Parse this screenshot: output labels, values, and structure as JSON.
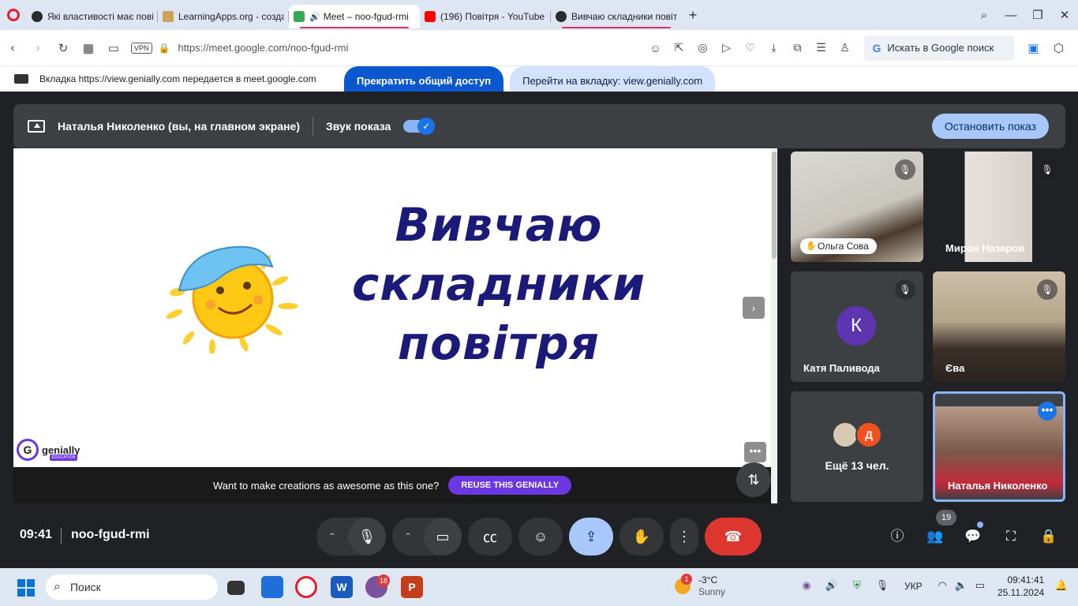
{
  "browser": {
    "tabs": [
      {
        "title": "Які властивості має пові",
        "favicon_color": "#2b2b2b",
        "active": false
      },
      {
        "title": "LearningApps.org - созда",
        "favicon_color": "#c9a45a",
        "active": false
      },
      {
        "title": "Meet – noo-fgud-rmi",
        "favicon_color": "#34a853",
        "active": true
      },
      {
        "title": "(196) Повітря - YouTube",
        "favicon_color": "#ff0000",
        "active": false
      },
      {
        "title": "Вивчаю складники повітр",
        "favicon_color": "#2b2b2b",
        "active": false
      }
    ],
    "url": "https://meet.google.com/noo-fgud-rmi",
    "vpn_label": "VPN",
    "search_placeholder": "Искать в Google поиск"
  },
  "sharing_bar": {
    "text": "Вкладка https://view.genially.com передается в meet.google.com",
    "stop_sharing": "Прекратить общий доступ",
    "go_to_tab": "Перейти на вкладку: view.genially.com"
  },
  "presentation": {
    "presenter": "Наталья Николенко (вы, на главном экране)",
    "sound_label": "Звук показа",
    "sound_on": true,
    "stop_button": "Остановить показ"
  },
  "slide": {
    "title_lines": [
      "Вивчаю",
      "складники",
      "повітря"
    ],
    "logo_text": "genially",
    "logo_badge": "EDUCATION",
    "reuse_text": "Want to make creations as awesome as this one?",
    "reuse_button": "REUSE THIS GENIALLY"
  },
  "participants": [
    {
      "name": "Ольга Сова",
      "muted": true,
      "hand_raised": true
    },
    {
      "name": "Мирон Назаров",
      "muted": true
    },
    {
      "name": "Катя Паливода",
      "muted": true,
      "initial": "К",
      "avatar_color": "#5e35b1"
    },
    {
      "name": "Єва",
      "muted": true
    },
    {
      "more_label": "Ещё 13 чел.",
      "avatar_initial": "Д"
    },
    {
      "name": "Наталья Николенко",
      "is_self": true
    }
  ],
  "controls": {
    "time": "09:41",
    "meeting_code": "noo-fgud-rmi",
    "participant_count": "19"
  },
  "taskbar": {
    "search_placeholder": "Поиск",
    "viber_badge": "18",
    "weather_badge": "1",
    "temperature": "-3°C",
    "weather_desc": "Sunny",
    "language": "УКР",
    "time": "09:41:41",
    "date": "25.11.2024"
  },
  "colors": {
    "meet_bg": "#202124",
    "accent_blue": "#1a73e8",
    "hangup_red": "#dc362e",
    "slide_title": "#1b1a79",
    "genially_purple": "#6b37e0"
  }
}
